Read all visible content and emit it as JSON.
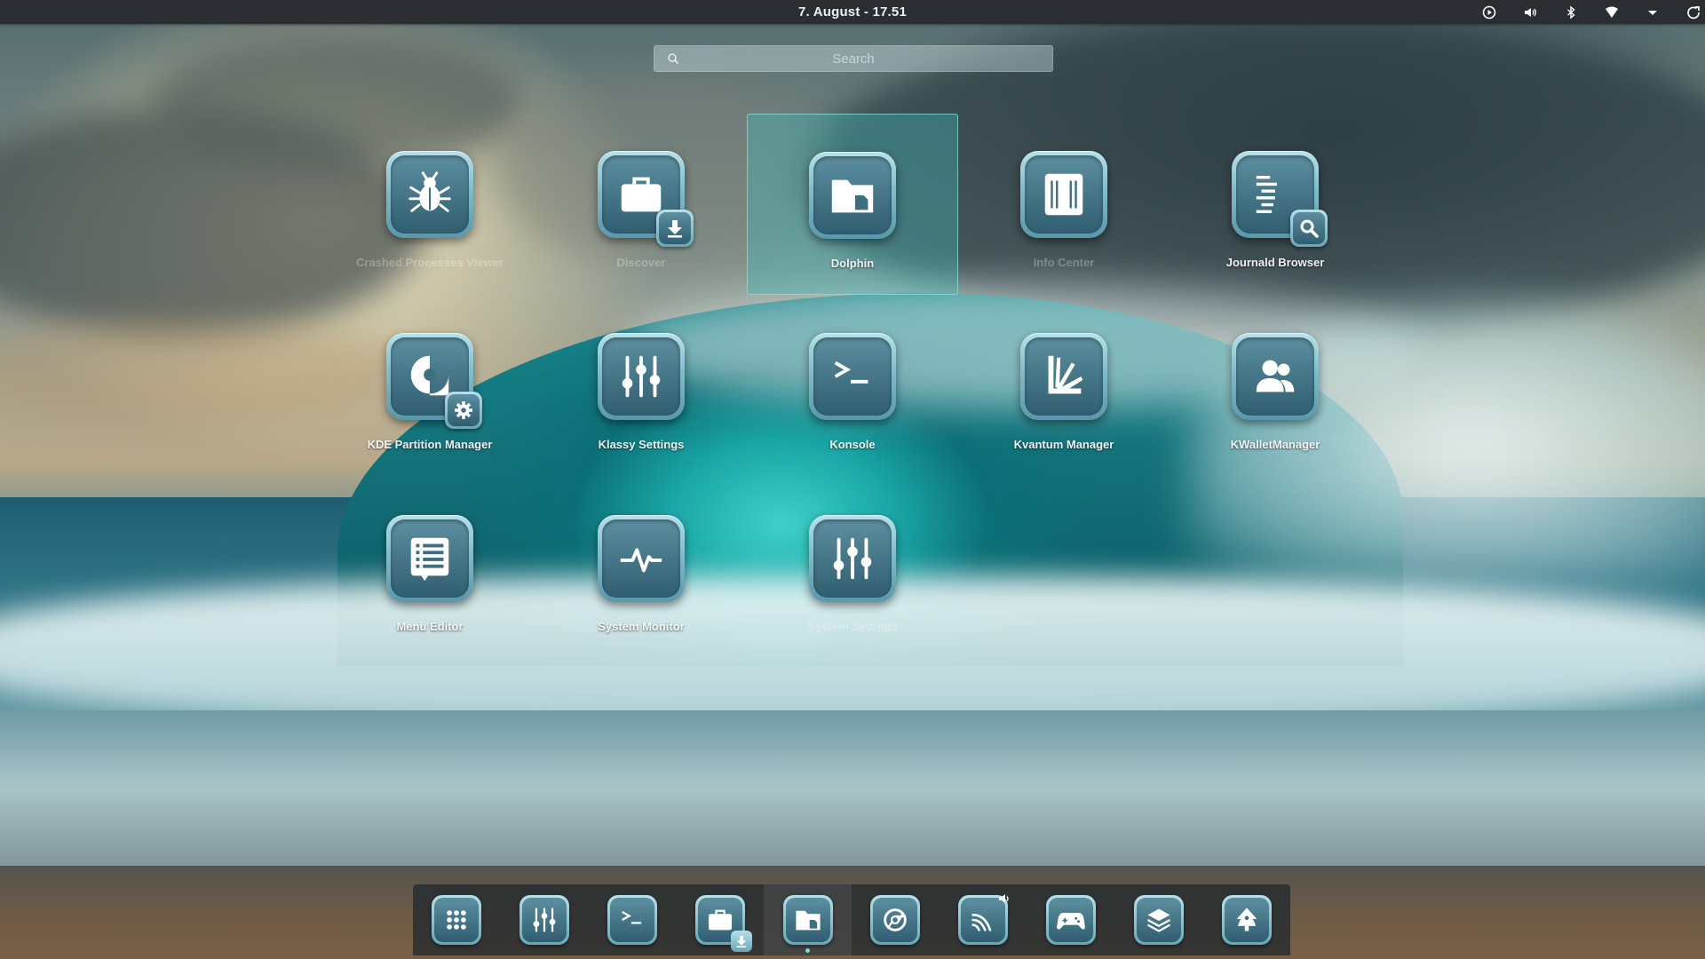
{
  "panel": {
    "clock": "7. August  -  17.51",
    "tray": [
      "media-play-icon",
      "volume-icon",
      "bluetooth-icon",
      "wifi-icon",
      "chevron-down-icon",
      "power-icon"
    ]
  },
  "search": {
    "placeholder": "Search",
    "value": ""
  },
  "apps": [
    {
      "label": "Crashed Processes Viewer",
      "icon": "bug-icon",
      "faint": true
    },
    {
      "label": "Discover",
      "icon": "briefcase-icon",
      "faint": true
    },
    {
      "label": "Dolphin",
      "icon": "folder-icon",
      "selected": true
    },
    {
      "label": "Info Center",
      "icon": "info-center-icon",
      "faint": true
    },
    {
      "label": "Journald Browser",
      "icon": "log-search-icon"
    },
    {
      "label": "KDE Partition Manager",
      "icon": "partition-icon"
    },
    {
      "label": "Klassy Settings",
      "icon": "sliders-icon"
    },
    {
      "label": "Konsole",
      "icon": "terminal-icon"
    },
    {
      "label": "Kvantum Manager",
      "icon": "kvantum-icon"
    },
    {
      "label": "KWalletManager",
      "icon": "users-icon"
    },
    {
      "label": "Menu Editor",
      "icon": "menu-list-icon"
    },
    {
      "label": "System Monitor",
      "icon": "pulse-icon"
    },
    {
      "label": "System Settings",
      "icon": "sliders-icon",
      "faint": true
    }
  ],
  "dock": [
    {
      "name": "app-grid",
      "icon": "grid-icon"
    },
    {
      "name": "klassy-settings",
      "icon": "sliders-icon"
    },
    {
      "name": "konsole",
      "icon": "terminal-icon"
    },
    {
      "name": "discover",
      "icon": "briefcase-icon"
    },
    {
      "name": "dolphin",
      "icon": "folder-icon",
      "active": true
    },
    {
      "name": "chromium",
      "icon": "chromium-icon"
    },
    {
      "name": "audio-player",
      "icon": "stream-icon"
    },
    {
      "name": "games",
      "icon": "gamepad-icon"
    },
    {
      "name": "layers",
      "icon": "layers-icon"
    },
    {
      "name": "launcher",
      "icon": "rocket-icon"
    }
  ],
  "colors": {
    "accent": "#40b9b9",
    "tile_top": "#b5e1ea",
    "tile_bottom": "#2f5e70",
    "panel": "#2a2d31"
  }
}
